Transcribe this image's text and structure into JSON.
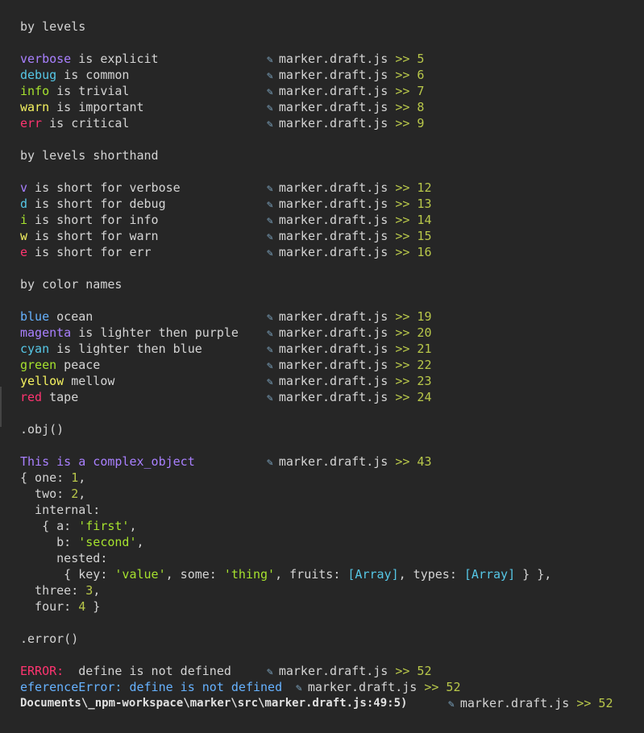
{
  "colors": {
    "background": "#262626",
    "verbose": "#a980ff",
    "debug": "#56c7e6",
    "info": "#a6e22e",
    "warn": "#f5f260",
    "err": "#ff3470",
    "blue": "#66b2ff",
    "line_number": "#b9c84a"
  },
  "icons": {
    "source_link": "pencil-icon"
  },
  "source": {
    "file": "marker.draft.js",
    "arrow": ">>"
  },
  "sections": {
    "by_levels": "by levels",
    "by_levels_shorthand": "by levels shorthand",
    "by_color_names": "by color names",
    "obj": ".obj()",
    "error": ".error()"
  },
  "levels": [
    {
      "kw": "verbose",
      "rest": " is explicit",
      "line": "5"
    },
    {
      "kw": "debug",
      "rest": " is common",
      "line": "6"
    },
    {
      "kw": "info",
      "rest": " is trivial",
      "line": "7"
    },
    {
      "kw": "warn",
      "rest": " is important",
      "line": "8"
    },
    {
      "kw": "err",
      "rest": " is critical",
      "line": "9"
    }
  ],
  "shorthand": [
    {
      "kw": "v",
      "rest": " is short for verbose",
      "line": "12"
    },
    {
      "kw": "d",
      "rest": " is short for debug",
      "line": "13"
    },
    {
      "kw": "i",
      "rest": " is short for info",
      "line": "14"
    },
    {
      "kw": "w",
      "rest": " is short for warn",
      "line": "15"
    },
    {
      "kw": "e",
      "rest": " is short for err",
      "line": "16"
    }
  ],
  "color_names": [
    {
      "kw": "blue",
      "rest": " ocean",
      "line": "19"
    },
    {
      "kw": "magenta",
      "rest": " is lighter then purple",
      "line": "20"
    },
    {
      "kw": "cyan",
      "rest": " is lighter then blue",
      "line": "21"
    },
    {
      "kw": "green",
      "rest": " peace",
      "line": "22"
    },
    {
      "kw": "yellow",
      "rest": " mellow",
      "line": "23"
    },
    {
      "kw": "red",
      "rest": " tape",
      "line": "24"
    }
  ],
  "obj": {
    "title": "This is a complex_object",
    "line": "43",
    "one_key": "{ one: ",
    "one_val": "1",
    "one_end": ",",
    "two_key": "  two: ",
    "two_val": "2",
    "two_end": ",",
    "internal": "  internal:",
    "a_key": "   { a: ",
    "a_val": "'first'",
    "a_end": ",",
    "b_key": "     b: ",
    "b_val": "'second'",
    "b_end": ",",
    "nested": "     nested:",
    "n1": "      { key: ",
    "n_key_val": "'value'",
    "n2": ", some: ",
    "n_some_val": "'thing'",
    "n3": ", fruits: ",
    "n_fruits_val": "[Array]",
    "n4": ", types: ",
    "n_types_val": "[Array]",
    "n5": " } },",
    "three_key": "  three: ",
    "three_val": "3",
    "three_end": ",",
    "four_key": "  four: ",
    "four_val": "4",
    "four_end": " }"
  },
  "error": {
    "label": "ERROR:",
    "message": "  define is not defined",
    "line1": "52",
    "ref_error": "eferenceError: define is not defined",
    "line2": "52",
    "path": "Documents\\_npm-workspace\\marker\\src\\marker.draft.js:49:5)",
    "line3": "52"
  }
}
